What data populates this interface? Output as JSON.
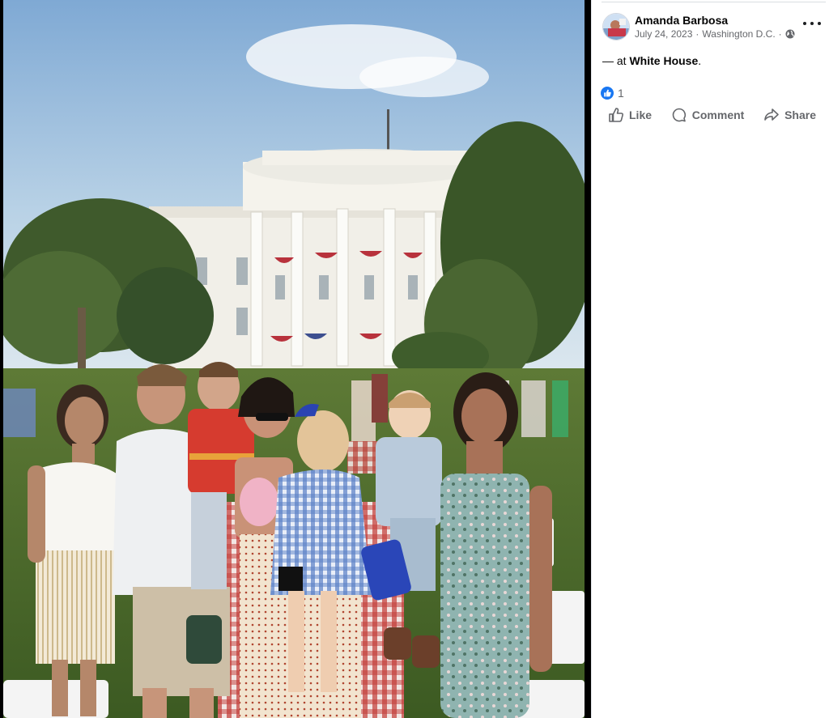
{
  "post": {
    "author": "Amanda Barbosa",
    "date": "July 24, 2023",
    "location": "Washington D.C.",
    "separator": "·",
    "visibility_icon": "globe-icon",
    "more_icon": "more-options-icon",
    "caption_prefix": "— at ",
    "caption_place": "White House",
    "caption_suffix": ".",
    "reaction_icon": "like-reaction-icon",
    "reaction_count": "1",
    "actions": {
      "like": "Like",
      "comment": "Comment",
      "share": "Share"
    }
  },
  "photo": {
    "subject": "group-photo-white-house",
    "colors": {
      "sky_top": "#8fb6d9",
      "sky_bottom": "#cfe0ec",
      "building": "#f2f0ea",
      "trees": "#3f5b2f",
      "lawn": "#4c6b2e"
    }
  },
  "accent": "#1877f2"
}
